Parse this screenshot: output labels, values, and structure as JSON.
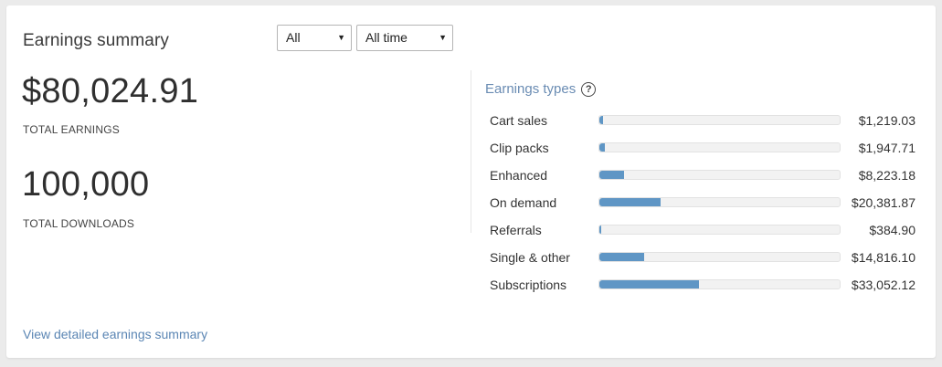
{
  "panel": {
    "title": "Earnings summary",
    "filters": [
      {
        "value": "All"
      },
      {
        "value": "All time"
      }
    ],
    "caret_glyph": "▼"
  },
  "totals": {
    "earnings_value": "$80,024.91",
    "earnings_label": "TOTAL EARNINGS",
    "downloads_value": "100,000",
    "downloads_label": "TOTAL DOWNLOADS"
  },
  "earnings_types": {
    "heading": "Earnings types",
    "help_glyph": "?",
    "scale_max": 80024.91,
    "items": [
      {
        "label": "Cart sales",
        "amount": "$1,219.03",
        "value": 1219.03
      },
      {
        "label": "Clip packs",
        "amount": "$1,947.71",
        "value": 1947.71
      },
      {
        "label": "Enhanced",
        "amount": "$8,223.18",
        "value": 8223.18
      },
      {
        "label": "On demand",
        "amount": "$20,381.87",
        "value": 20381.87
      },
      {
        "label": "Referrals",
        "amount": "$384.90",
        "value": 384.9
      },
      {
        "label": "Single & other",
        "amount": "$14,816.10",
        "value": 14816.1
      },
      {
        "label": "Subscriptions",
        "amount": "$33,052.12",
        "value": 33052.12
      }
    ]
  },
  "footer": {
    "link_label": "View detailed earnings summary"
  },
  "colors": {
    "accent": "#5f96c5",
    "link": "#5b86b4",
    "track": "#f2f2f2"
  }
}
